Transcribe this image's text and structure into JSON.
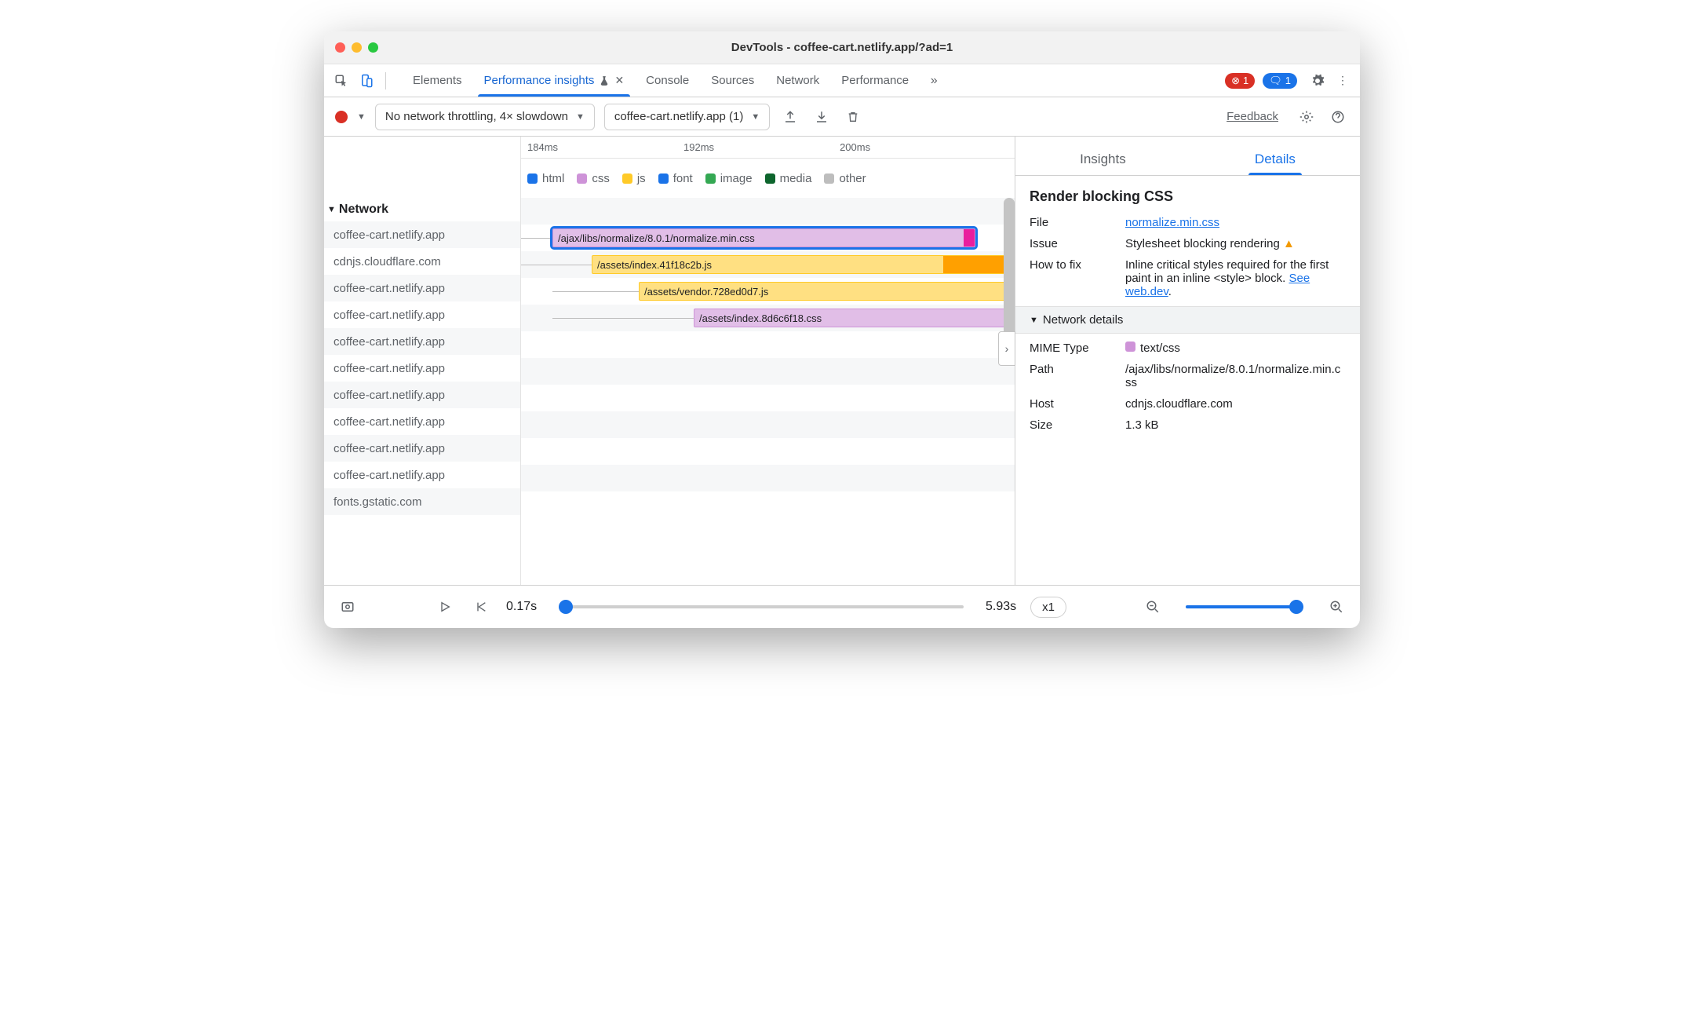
{
  "window": {
    "title": "DevTools - coffee-cart.netlify.app/?ad=1"
  },
  "top_tabs": {
    "elements": "Elements",
    "perf_insights": "Performance insights",
    "console": "Console",
    "sources": "Sources",
    "network": "Network",
    "performance": "Performance"
  },
  "counters": {
    "errors": "1",
    "info": "1"
  },
  "toolbar": {
    "throttle": "No network throttling, 4× slowdown",
    "target": "coffee-cart.netlify.app (1)",
    "feedback": "Feedback"
  },
  "ruler": [
    "184ms",
    "192ms",
    "200ms"
  ],
  "legend": {
    "html": "html",
    "css": "css",
    "js": "js",
    "font": "font",
    "image": "image",
    "media": "media",
    "other": "other"
  },
  "left": {
    "title": "Network",
    "rows": [
      "coffee-cart.netlify.app",
      "cdnjs.cloudflare.com",
      "coffee-cart.netlify.app",
      "coffee-cart.netlify.app",
      "coffee-cart.netlify.app",
      "coffee-cart.netlify.app",
      "coffee-cart.netlify.app",
      "coffee-cart.netlify.app",
      "coffee-cart.netlify.app",
      "coffee-cart.netlify.app",
      "fonts.gstatic.com"
    ]
  },
  "bars": {
    "b1": "/ajax/libs/normalize/8.0.1/normalize.min.css",
    "b2": "/assets/index.41f18c2b.js",
    "b3": "/assets/vendor.728ed0d7.js",
    "b4": "/assets/index.8d6c6f18.css"
  },
  "right": {
    "tab_insights": "Insights",
    "tab_details": "Details",
    "heading": "Render blocking CSS",
    "file_k": "File",
    "file_v": "normalize.min.css",
    "issue_k": "Issue",
    "issue_v": "Stylesheet blocking rendering",
    "fix_k": "How to fix",
    "fix_v1": "Inline critical styles required for the first paint in an inline <style> block. ",
    "fix_link": "See web.dev",
    "net_head": "Network details",
    "mime_k": "MIME Type",
    "mime_v": "text/css",
    "path_k": "Path",
    "path_v": "/ajax/libs/normalize/8.0.1/normalize.min.css",
    "host_k": "Host",
    "host_v": "cdnjs.cloudflare.com",
    "size_k": "Size",
    "size_v": "1.3 kB"
  },
  "bottom": {
    "t_start": "0.17s",
    "t_end": "5.93s",
    "speed": "x1"
  },
  "colors": {
    "html": "#1a73e8",
    "css": "#ce93d8",
    "js": "#ffca28",
    "font": "#1a73e8",
    "image": "#34a853",
    "media": "#0d652d",
    "other": "#bdbdbd"
  }
}
